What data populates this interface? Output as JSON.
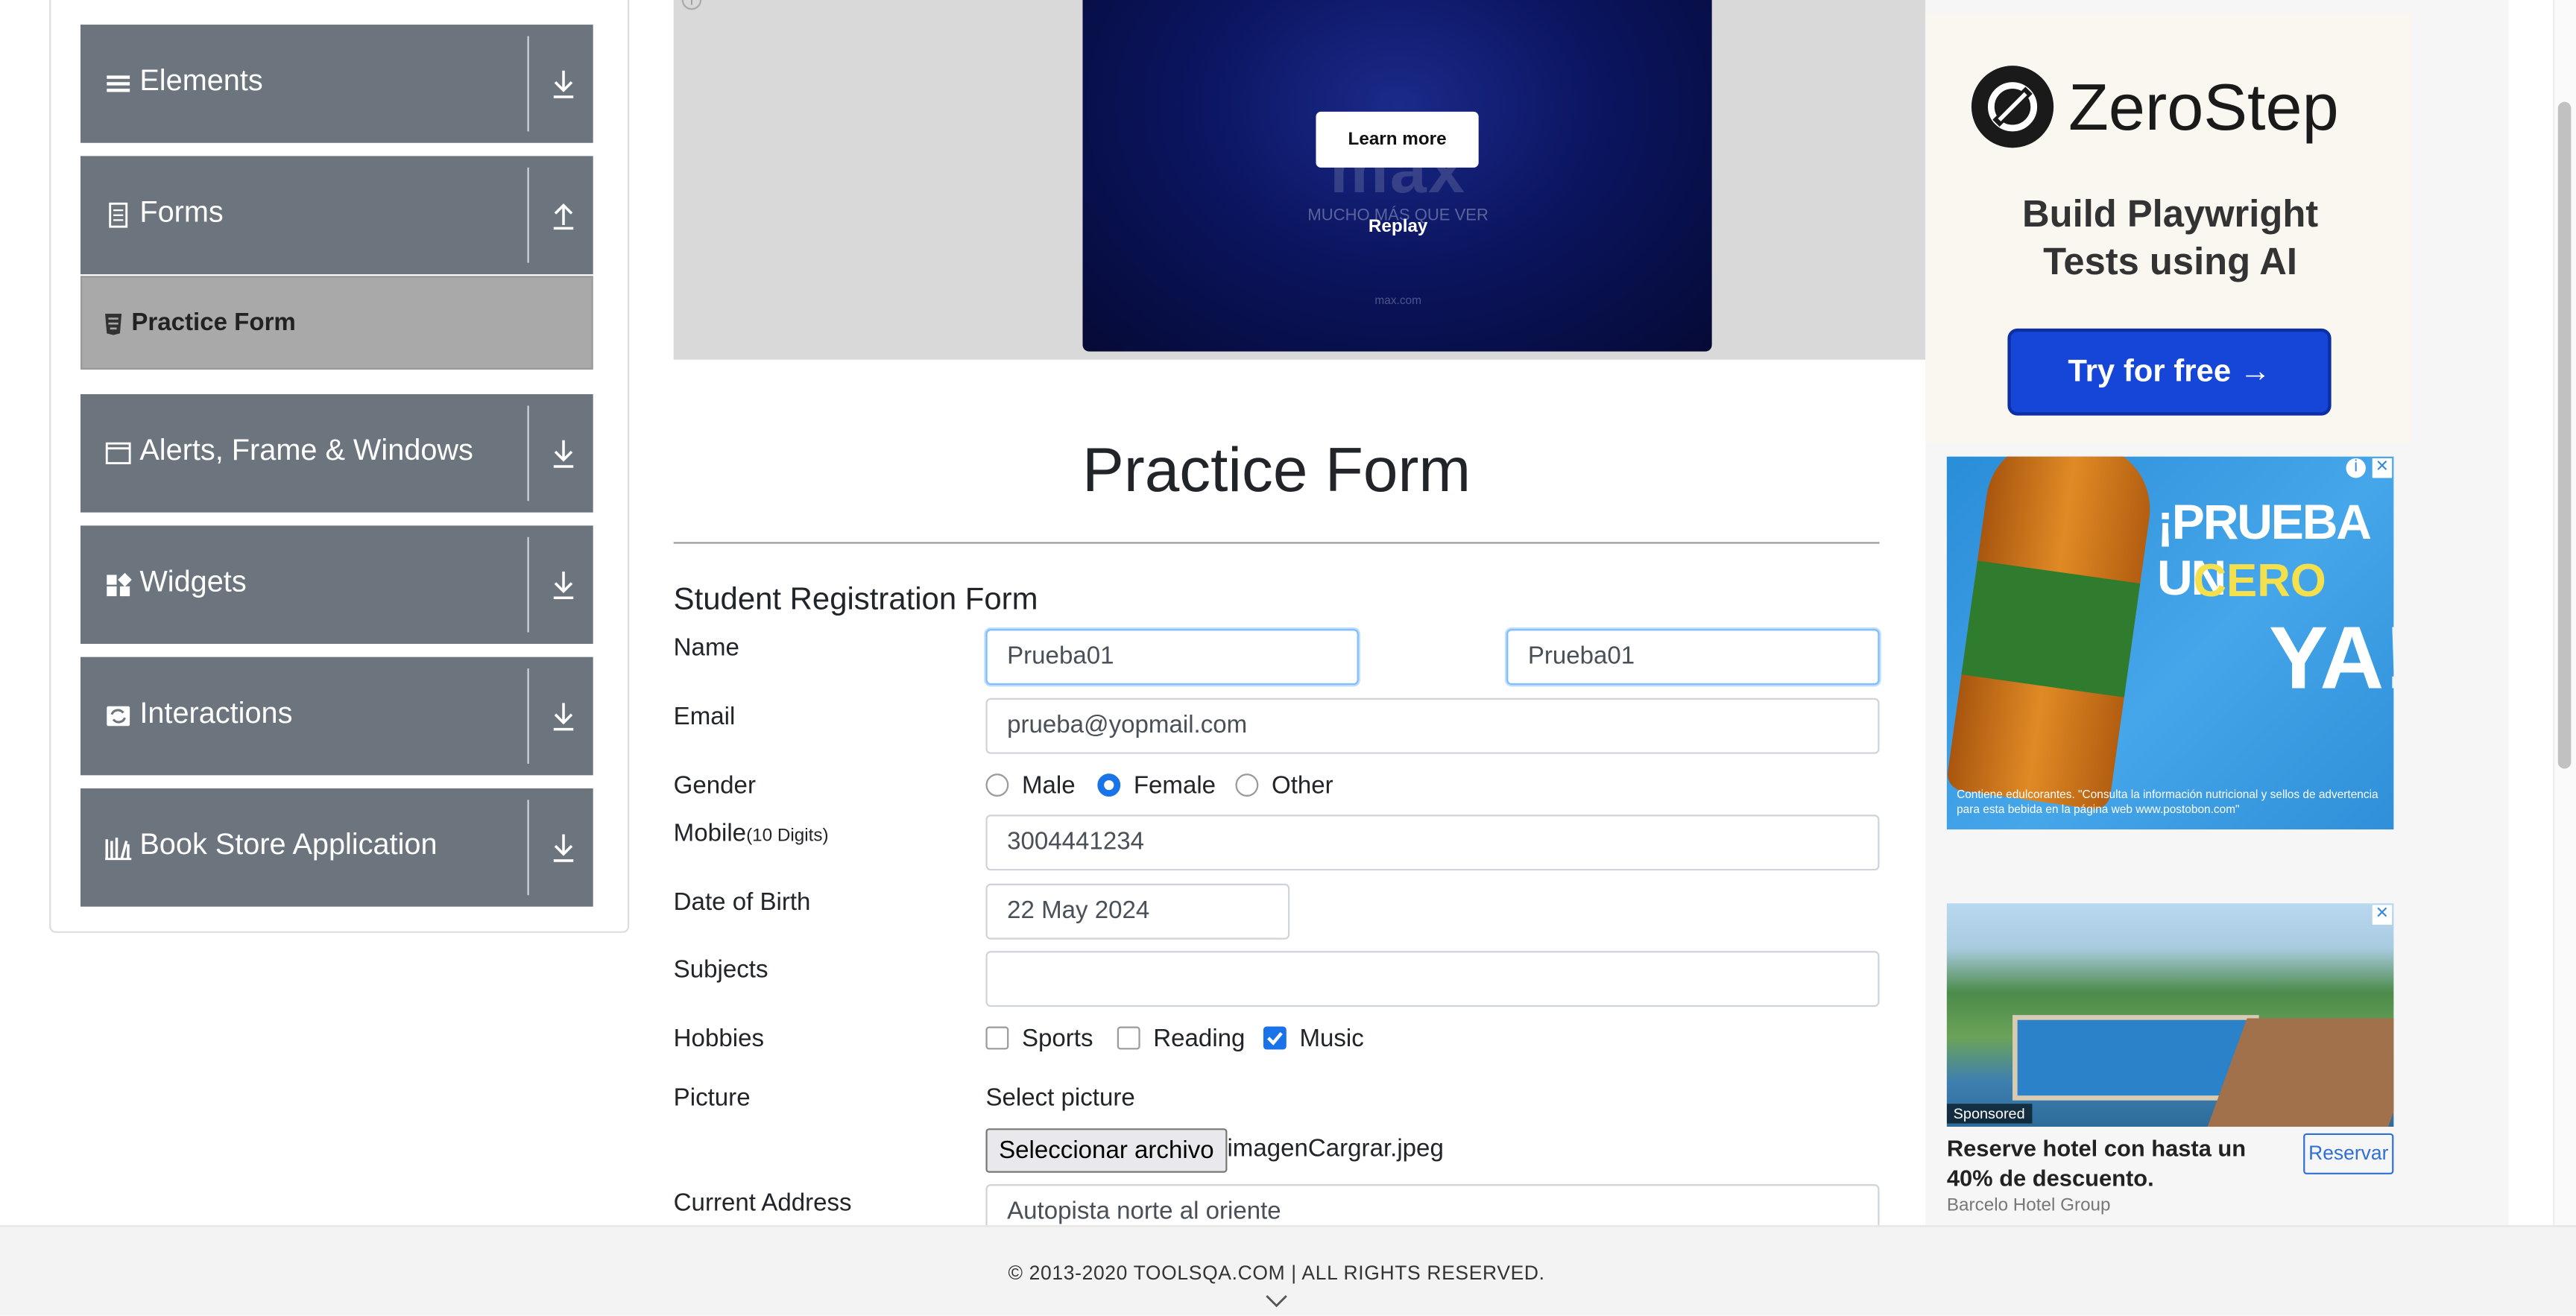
{
  "sidebar": {
    "groups": [
      {
        "title": "Elements",
        "icon": "hamburger-icon",
        "arrow": "download-arrow-icon"
      },
      {
        "title": "Forms",
        "icon": "document-icon",
        "arrow": "upload-arrow-icon"
      },
      {
        "title": "Alerts, Frame & Windows",
        "icon": "window-icon",
        "arrow": "download-arrow-icon"
      },
      {
        "title": "Widgets",
        "icon": "widgets-icon",
        "arrow": "download-arrow-icon"
      },
      {
        "title": "Interactions",
        "icon": "interactions-icon",
        "arrow": "download-arrow-icon"
      },
      {
        "title": "Book Store Application",
        "icon": "bookstore-icon",
        "arrow": "download-arrow-icon"
      }
    ],
    "active_item": "Practice Form"
  },
  "banner_ad": {
    "learn_more": "Learn more",
    "brand": "max",
    "tagline": "MUCHO MÁS QUE VER",
    "replay": "Replay",
    "url": "max.com"
  },
  "main": {
    "page_title": "Practice Form",
    "form_title": "Student Registration Form",
    "name_label": "Name",
    "first_name": "Prueba01",
    "last_name": "Prueba01",
    "email_label": "Email",
    "email": "prueba@yopmail.com",
    "gender_label": "Gender",
    "genders": [
      "Male",
      "Female",
      "Other"
    ],
    "gender_selected": "Female",
    "mobile_label": "Mobile",
    "mobile_hint": "(10 Digits)",
    "mobile": "3004441234",
    "dob_label": "Date of Birth",
    "dob": "22 May 2024",
    "subjects_label": "Subjects",
    "subjects": "",
    "hobbies_label": "Hobbies",
    "hobbies": [
      "Sports",
      "Reading",
      "Music"
    ],
    "hobbies_checked": [
      "Music"
    ],
    "picture_label": "Picture",
    "picture_prompt": "Select picture",
    "file_button": "Seleccionar archivo",
    "file_name": "imagenCargrar.jpeg",
    "address_label": "Current Address",
    "address": "Autopista norte al oriente"
  },
  "right_ads": {
    "zerostep": {
      "brand": "ZeroStep",
      "headline": "Build Playwright Tests using AI",
      "cta": "Try for free →"
    },
    "tea": {
      "line1": "¡PRUEBA UN",
      "line2": "CERO",
      "line3": "YA!",
      "disclaimer": "Contiene edulcorantes. \"Consulta la información nutricional y sellos de advertencia para esta bebida en la página web www.postobon.com\""
    },
    "hotel": {
      "sponsored": "Sponsored",
      "text": "Reserve hotel con hasta un 40% de descuento.",
      "source": "Barcelo Hotel Group",
      "button": "Reservar"
    }
  },
  "footer": {
    "copyright": "© 2013-2020 TOOLSQA.COM | ALL RIGHTS RESERVED."
  },
  "colors": {
    "sidebar_group": "#6c757d",
    "active_item": "#a9a9a9",
    "accent": "#1a73e8",
    "zerostep_cta": "#1546d8"
  }
}
